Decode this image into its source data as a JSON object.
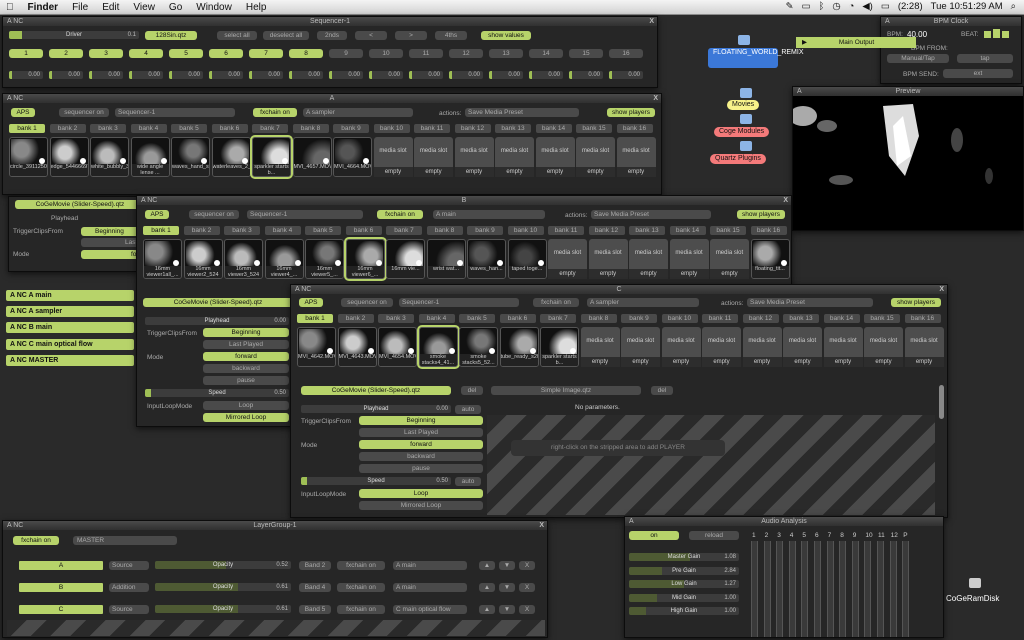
{
  "menubar": {
    "app": "Finder",
    "items": [
      "File",
      "Edit",
      "View",
      "Go",
      "Window",
      "Help"
    ],
    "battery": "(2:28)",
    "clock": "Tue 10:51:29 AM"
  },
  "sequencer": {
    "title": "Sequencer-1",
    "ctl": "A",
    "nc": "NC",
    "file": "128Sin.qtz",
    "driver": "Driver",
    "val": "0.1",
    "buttons": [
      "select all",
      "deselect all",
      "2nds",
      "<",
      ">",
      "4ths",
      "show values"
    ],
    "steps": [
      "1",
      "2",
      "3",
      "4",
      "5",
      "6",
      "7",
      "8",
      "9",
      "10",
      "11",
      "12",
      "13",
      "14",
      "15",
      "16"
    ],
    "values": "0.00"
  },
  "bpm": {
    "title": "BPM Clock",
    "ctl": "A",
    "bpm_label": "BPM:",
    "bpm": "40.00",
    "beat": "BEAT:",
    "bpm_from_label": "BPM FROM:",
    "bpm_from": "Manual/Tap",
    "tap": "tap",
    "bpm_send_label": "BPM SEND:",
    "bpm_send": "ext",
    "main_output": "Main Output"
  },
  "desktop": {
    "folders": [
      "FLOATING_WORLD_REMIX",
      "Movies",
      "Coge Modules",
      "Quartz Plugins"
    ],
    "disk": "CoGeRamDisk"
  },
  "preview": {
    "title": "Preview",
    "ctl": "A"
  },
  "banks": [
    "bank 1",
    "bank 2",
    "bank 3",
    "bank 4",
    "bank 5",
    "bank 6",
    "bank 7",
    "bank 8",
    "bank 9",
    "bank 10",
    "bank 11",
    "bank 12",
    "bank 13",
    "bank 14",
    "bank 15",
    "bank 16"
  ],
  "common": {
    "aps": "APS",
    "seq_on": "sequencer on",
    "seq_name": "Sequencer-1",
    "fxchain": "fxchain on",
    "actions": "actions:",
    "save_preset": "Save Media Preset",
    "show_players": "show players",
    "media_slot": "media slot",
    "empty": "empty"
  },
  "winA": {
    "title": "A",
    "ctl": "A",
    "nc": "NC",
    "sampler": "A sampler",
    "clips": [
      "circle_391125072...",
      "edge_544666976.m",
      "white_bubbly_388...",
      "wide angle lense ...",
      "waves_hand_shutte...",
      "waterleaves_2_spl...",
      "sparkler starts b...",
      "MVI_4657.MOV.mov",
      "MVI_4664.MOV.mov"
    ]
  },
  "winB": {
    "title": "B",
    "ctl": "A",
    "nc": "NC",
    "main": "A main",
    "clips": [
      "16mm viewer1all_...",
      "16mm viewer2_524",
      "16mm viewer3_524",
      "16mm viewer4_...",
      "16mm viewer5_...",
      "16mm viewer6_...",
      "16mm vie...",
      "wrist wat...",
      "waves_han...",
      "taped toge...",
      "",
      "",
      "",
      "",
      "",
      "floating_tit..."
    ],
    "player": "CoGeMovie (Slider-Speed).qtz",
    "playhead": "Playhead",
    "playhead_val": "0.00",
    "trigger": "TriggerClipsFrom",
    "trig_opts": [
      "Beginning",
      "Last Played"
    ],
    "mode": "Mode",
    "modes": [
      "forward",
      "backward",
      "pause"
    ],
    "speed": "Speed",
    "speed_val": "0.50",
    "loopmode": "InputLoopMode",
    "loops": [
      "Loop",
      "Mirrored Loop"
    ]
  },
  "winC": {
    "title": "C",
    "ctl": "A",
    "nc": "NC",
    "sampler": "A sampler",
    "clips": [
      "MVI_4642.MOV.mov",
      "MVI_4643.MOV_414...",
      "MVI_4654.MOV_543...",
      "smoke stacks4_41...",
      "smoke stacks5_52...",
      "tube_ready_s20.mov",
      "sparkler starts b..."
    ],
    "player": "CoGeMovie (Slider-Speed).qtz",
    "del": "del",
    "simple": "Simple Image.qtz",
    "no_params": "No parameters.",
    "hint": "right-click on the stripped area to add PLAYER",
    "playhead": "Playhead",
    "playhead_val": "0.00",
    "auto": "auto",
    "trigger": "TriggerClipsFrom",
    "trig_opts": [
      "Beginning",
      "Last Played"
    ],
    "mode": "Mode",
    "modes": [
      "forward",
      "backward",
      "pause"
    ],
    "speed": "Speed",
    "speed_val": "0.50",
    "loopmode": "InputLoopMode",
    "loops": [
      "Loop",
      "Mirrored Loop"
    ]
  },
  "sidebar": [
    "A   NC        A main",
    "A   NC        A sampler",
    "A   NC        B main",
    "A   NC C main optical flow",
    "A   NC        MASTER"
  ],
  "layergroup": {
    "title": "LayerGroup-1",
    "ctl": "A",
    "nc": "NC",
    "fxchain": "fxchain on",
    "master": "MASTER",
    "rows": [
      {
        "name": "A",
        "mode": "Source",
        "opacity": "Opacity",
        "val": "0.52",
        "band": "Band 2",
        "fx": "fxchain on",
        "src": "A main"
      },
      {
        "name": "B",
        "mode": "Addition",
        "opacity": "Opacity",
        "val": "0.61",
        "band": "Band 4",
        "fx": "fxchain on",
        "src": "A main"
      },
      {
        "name": "C",
        "mode": "Source",
        "opacity": "Opacity",
        "val": "0.61",
        "band": "Band 5",
        "fx": "fxchain on",
        "src": "C main optical flow"
      }
    ],
    "arrows": [
      "▲",
      "▼",
      "X"
    ]
  },
  "audio": {
    "title": "Audio Analysis",
    "ctl": "A",
    "on": "on",
    "reload": "reload",
    "gains": [
      {
        "l": "Master Gain",
        "v": "1.08",
        "f": 0.55
      },
      {
        "l": "Pre Gain",
        "v": "2.84",
        "f": 0.3
      },
      {
        "l": "Low Gain",
        "v": "1.27",
        "f": 0.5
      },
      {
        "l": "Mid Gain",
        "v": "1.00",
        "f": 0.25
      },
      {
        "l": "High Gain",
        "v": "1.00",
        "f": 0.15
      }
    ],
    "bands": [
      "1",
      "2",
      "3",
      "4",
      "5",
      "6",
      "7",
      "8",
      "9",
      "10",
      "11",
      "12",
      "P"
    ]
  },
  "colors": {
    "accent": "#b7d36a",
    "bg": "#2a2a2a",
    "panel": "#262626"
  }
}
